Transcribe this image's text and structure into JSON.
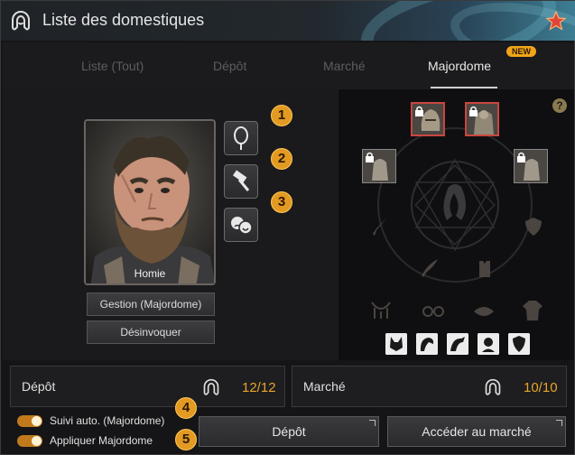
{
  "window": {
    "title": "Liste des domestiques"
  },
  "tabs": [
    {
      "label": "Liste (Tout)",
      "active": false
    },
    {
      "label": "Dépôt",
      "active": false
    },
    {
      "label": "Marché",
      "active": false
    },
    {
      "label": "Majordome",
      "active": true
    }
  ],
  "new_badge": "NEW",
  "portrait": {
    "name": "Homie"
  },
  "side_buttons": [
    {
      "icon": "mirror-icon",
      "badge": "1"
    },
    {
      "icon": "hammer-icon",
      "badge": "2"
    },
    {
      "icon": "emotion-masks-icon",
      "badge": "3"
    }
  ],
  "buttons": {
    "manage": "Gestion (Majordome)",
    "dismiss": "Désinvoquer",
    "deposit": "Dépôt",
    "market": "Accéder au marché"
  },
  "help": "?",
  "stats": {
    "deposit": {
      "label": "Dépôt",
      "value": "12/12"
    },
    "market": {
      "label": "Marché",
      "value": "10/10"
    }
  },
  "toggles": [
    {
      "label": "Suivi auto. (Majordome)",
      "on": true,
      "badge": "4"
    },
    {
      "label": "Appliquer Majordome",
      "on": true,
      "badge": "5"
    }
  ],
  "equipment_icons": [
    "sword-icon",
    "shield-icon",
    "knife-icon",
    "armor-icon",
    "necklace-icon",
    "glasses-icon",
    "lips-icon",
    "clothes-icon"
  ],
  "small_slots": [
    "mask-icon",
    "hair-icon",
    "hair-icon",
    "face-icon",
    "shield-icon"
  ],
  "colors": {
    "accent": "#e29a22",
    "value": "#e8a52a",
    "red_border": "#c9463e"
  }
}
